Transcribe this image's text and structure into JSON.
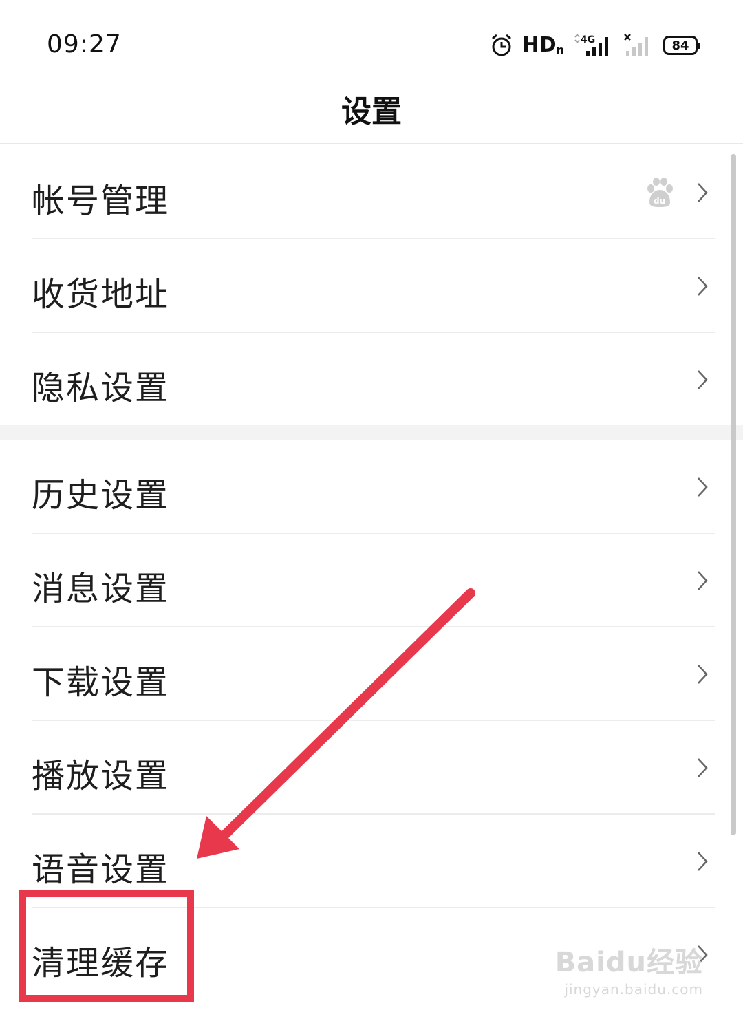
{
  "status_bar": {
    "time": "09:27",
    "hd_label": "HD",
    "hd_sub": "n",
    "network_label": "4G",
    "battery": "84"
  },
  "header": {
    "title": "设置"
  },
  "sections": [
    {
      "items": [
        {
          "label": "帐号管理",
          "icon": "baidu-paw-icon"
        },
        {
          "label": "收货地址"
        },
        {
          "label": "隐私设置"
        }
      ]
    },
    {
      "items": [
        {
          "label": "历史设置"
        },
        {
          "label": "消息设置"
        },
        {
          "label": "下载设置"
        },
        {
          "label": "播放设置"
        },
        {
          "label": "语音设置"
        },
        {
          "label": "清理缓存"
        }
      ]
    }
  ],
  "watermark": {
    "main": "Baidu经验",
    "sub": "jingyan.baidu.com"
  },
  "colors": {
    "annotation": "#e8394c",
    "divider": "#ececec",
    "section_gap": "#f3f3f3"
  }
}
